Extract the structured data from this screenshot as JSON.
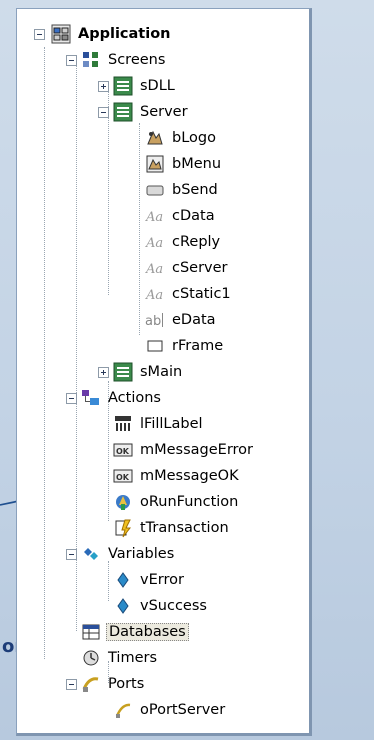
{
  "side_label": "ons",
  "tree": {
    "application": "Application",
    "screens": "Screens",
    "sdll": "sDLL",
    "server": "Server",
    "server_items": [
      "bLogo",
      "bMenu",
      "bSend",
      "cData",
      "cReply",
      "cServer",
      "cStatic1",
      "eData",
      "rFrame"
    ],
    "smain": "sMain",
    "actions": "Actions",
    "action_items": [
      "lFillLabel",
      "mMessageError",
      "mMessageOK",
      "oRunFunction",
      "tTransaction"
    ],
    "variables": "Variables",
    "variable_items": [
      "vError",
      "vSuccess"
    ],
    "databases": "Databases",
    "timers": "Timers",
    "ports": "Ports",
    "port_items": [
      "oPortServer"
    ]
  },
  "colors": {
    "accent": "#1d3d78",
    "selection": "#eceadf"
  }
}
